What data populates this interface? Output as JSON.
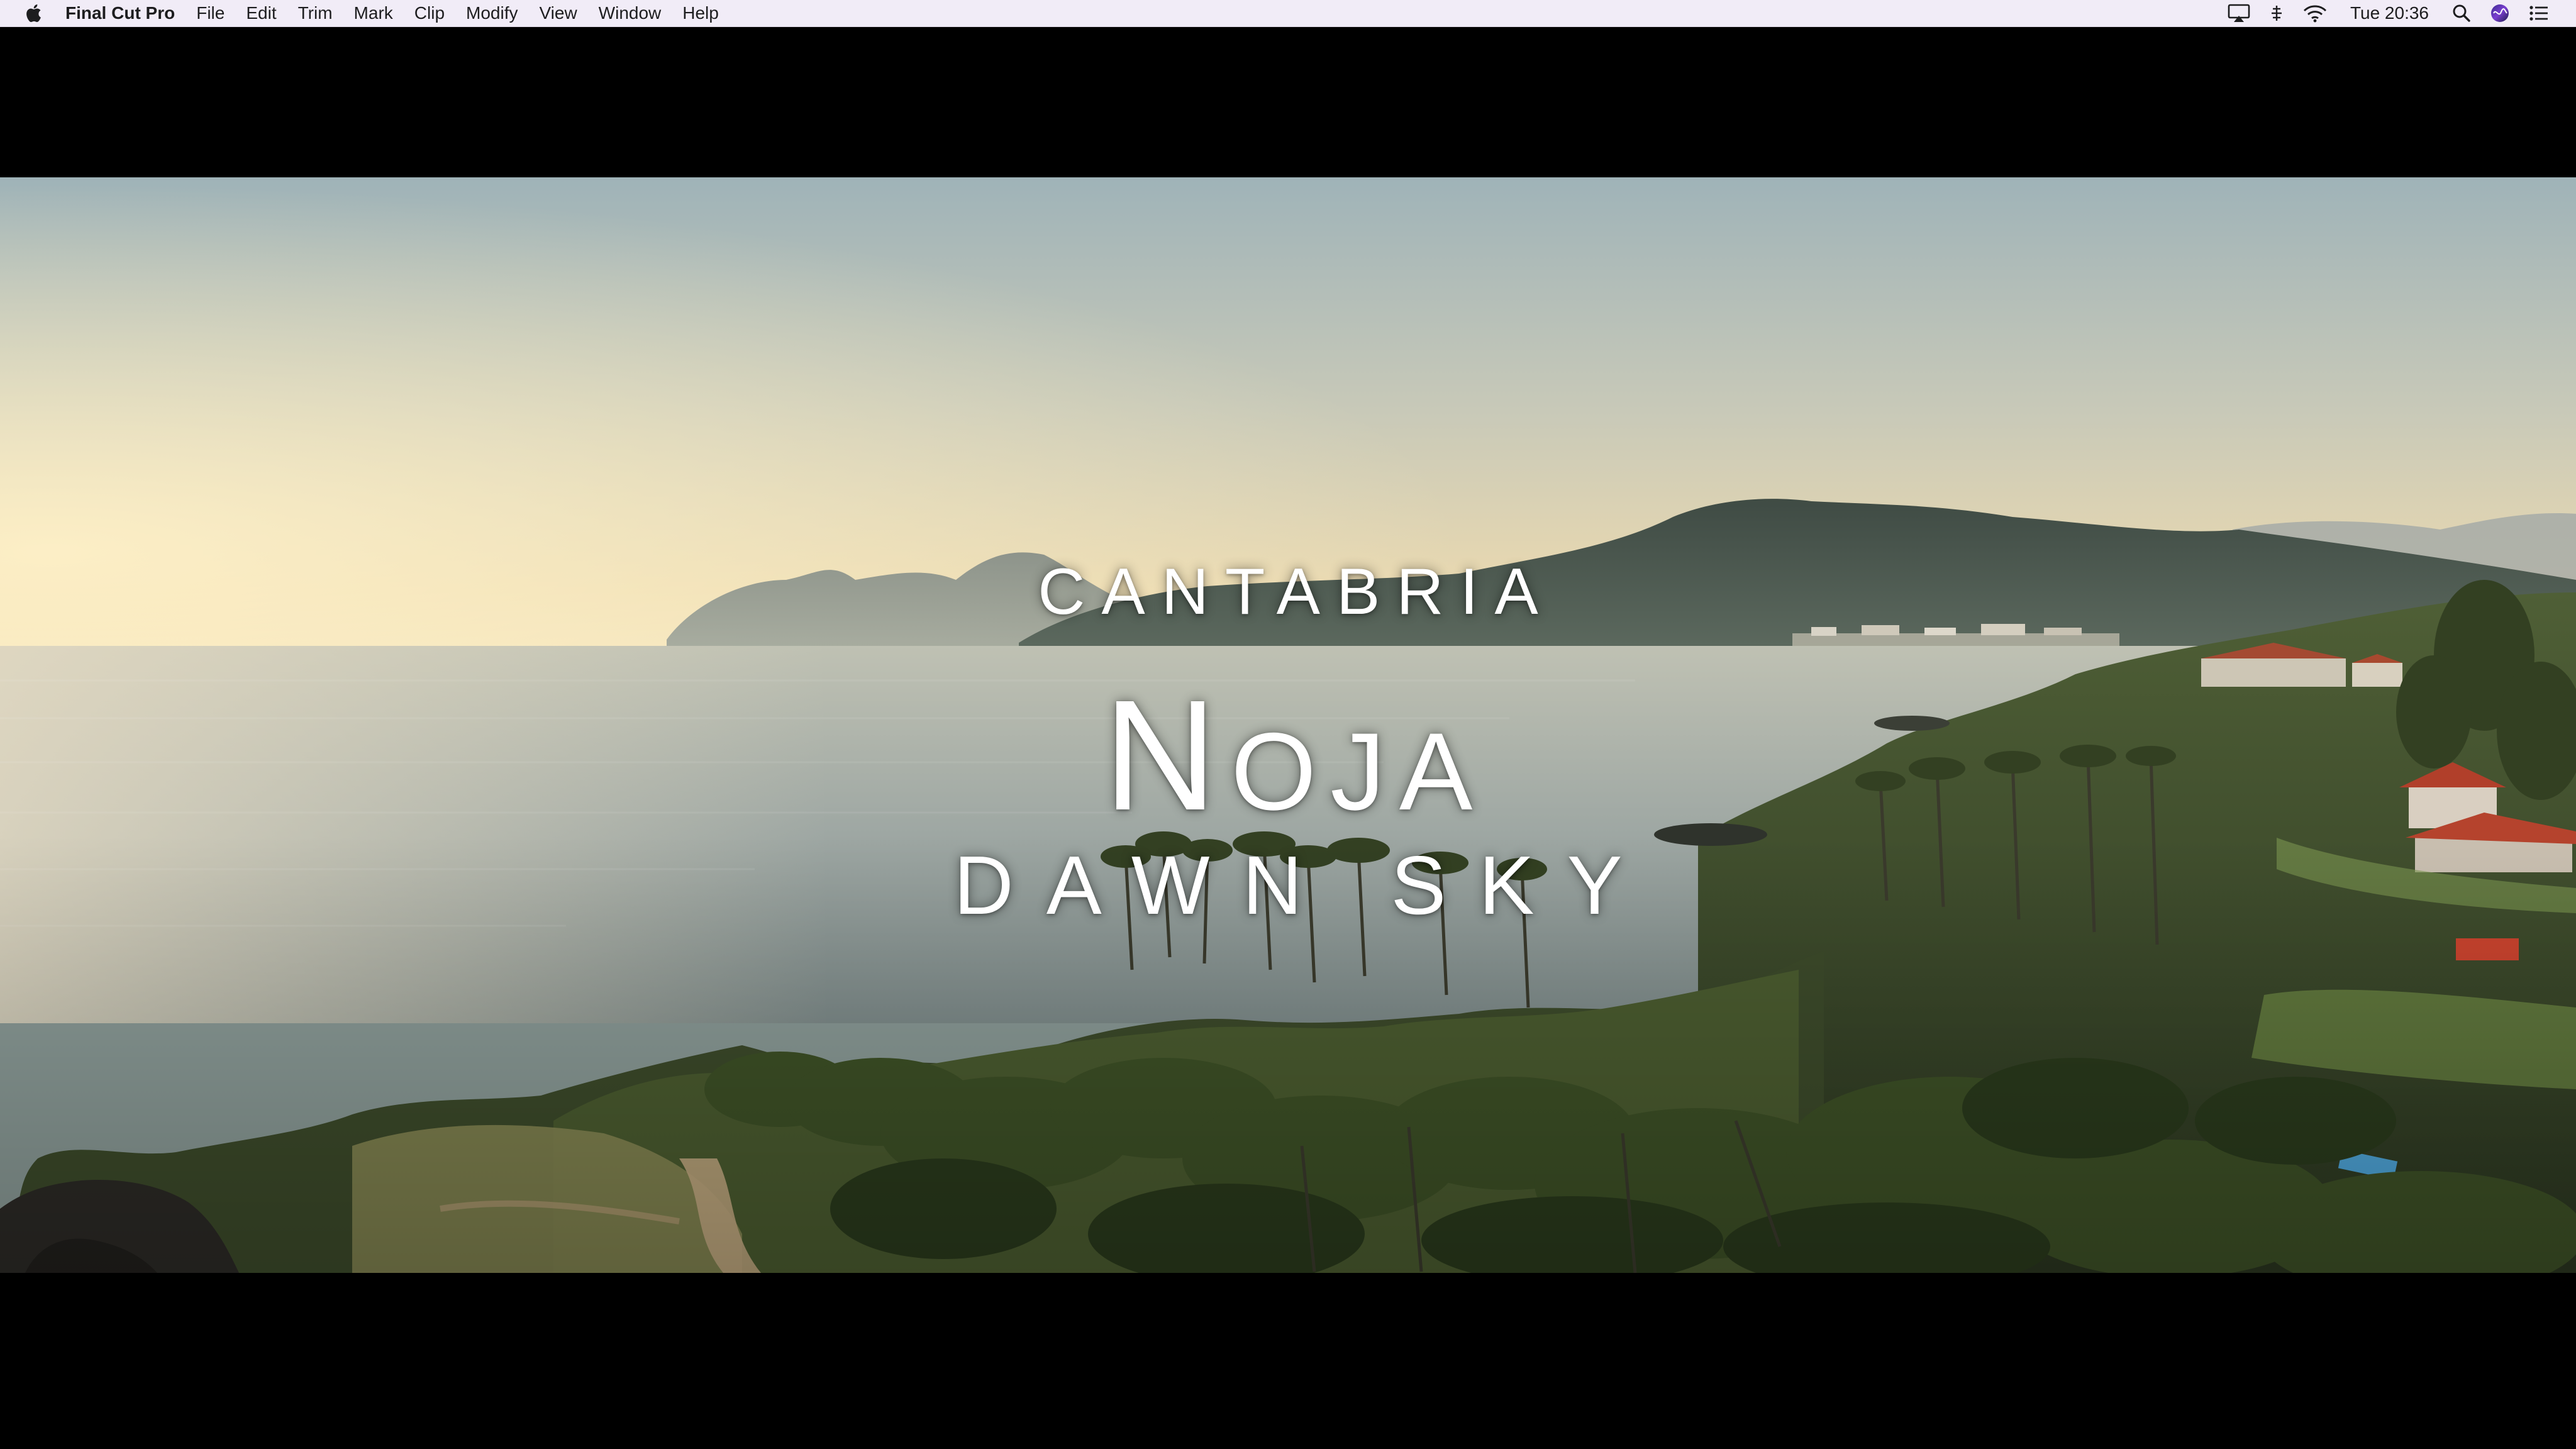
{
  "menubar": {
    "app_name": "Final Cut Pro",
    "menus": [
      "File",
      "Edit",
      "Trim",
      "Mark",
      "Clip",
      "Modify",
      "View",
      "Window",
      "Help"
    ],
    "clock": "Tue 20:36",
    "status_icons": [
      "airplay-icon",
      "control-icon",
      "wifi-icon",
      "search-icon",
      "siri-icon",
      "notification-center-icon"
    ]
  },
  "viewer": {
    "title": {
      "line1": "CANTABRIA",
      "line2_initial": "N",
      "line2_rest": "OJA",
      "line3": "DAWN SKY"
    }
  },
  "colors": {
    "menubar_bg": "#f1ecf7",
    "letterbox": "#000000",
    "title_text": "#ffffff"
  }
}
